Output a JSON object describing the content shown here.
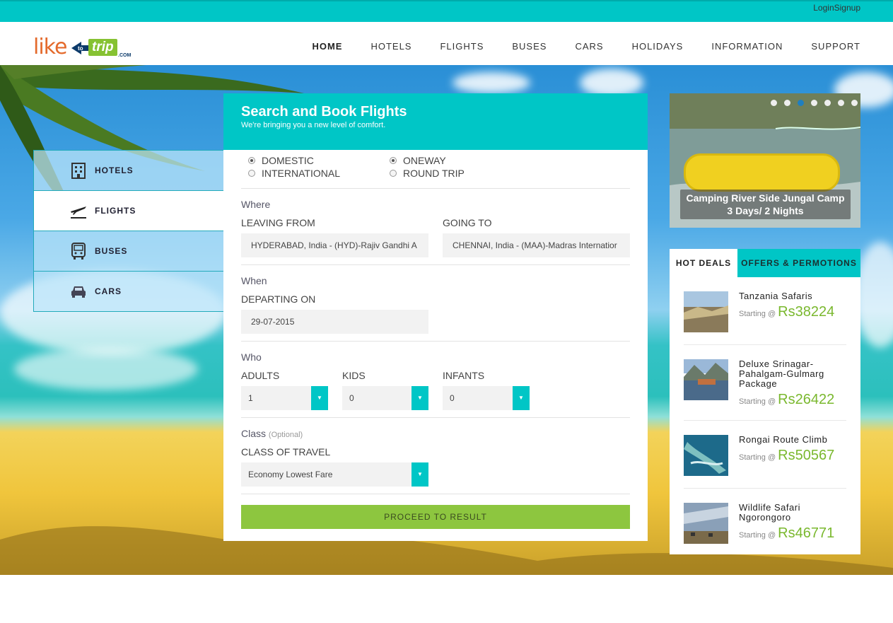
{
  "top_links": {
    "login": "Login",
    "signup": "Signup"
  },
  "logo": {
    "like": "like",
    "to": "to",
    "trip": "trip",
    "com": ".COM"
  },
  "nav": [
    "HOME",
    "HOTELS",
    "FLIGHTS",
    "BUSES",
    "CARS",
    "HOLIDAYS",
    "INFORMATION",
    "SUPPORT"
  ],
  "tabs": [
    {
      "label": "HOTELS",
      "icon": "hotel-icon"
    },
    {
      "label": "FLIGHTS",
      "icon": "plane-icon"
    },
    {
      "label": "BUSES",
      "icon": "bus-icon"
    },
    {
      "label": "CARS",
      "icon": "car-icon"
    }
  ],
  "form": {
    "title": "Search and Book Flights",
    "subtitle": "We're bringing you a new level of comfort.",
    "radios": {
      "domestic": "DOMESTIC",
      "international": "INTERNATIONAL",
      "oneway": "ONEWAY",
      "round_trip": "ROUND TRIP"
    },
    "where": {
      "title": "Where",
      "leaving_label": "LEAVING FROM",
      "leaving_value": "HYDERABAD, India - (HYD)-Rajiv Gandhi A",
      "going_label": "GOING TO",
      "going_value": "CHENNAI, India - (MAA)-Madras Internatior"
    },
    "when": {
      "title": "When",
      "departing_label": "DEPARTING ON",
      "departing_value": "29-07-2015"
    },
    "who": {
      "title": "Who",
      "adults_label": "ADULTS",
      "adults_value": "1",
      "kids_label": "KIDS",
      "kids_value": "0",
      "infants_label": "INFANTS",
      "infants_value": "0"
    },
    "class": {
      "title": "Class",
      "optional": "(Optional)",
      "label": "CLASS OF TRAVEL",
      "value": "Economy Lowest Fare"
    },
    "proceed": "PROCEED TO RESULT"
  },
  "slider": {
    "caption_line1": "Camping River Side Jungal Camp",
    "caption_line2": "3 Days/ 2 Nights",
    "active_dot": 2
  },
  "deals": {
    "tab_hot": "HOT DEALS",
    "tab_offers": "OFFERS & PERMOTIONS",
    "starting": "Starting @",
    "items": [
      {
        "name": "Tanzania Safaris",
        "price": "Rs38224"
      },
      {
        "name": "Deluxe Srinagar-Pahalgam-Gulmarg Package",
        "price": "Rs26422"
      },
      {
        "name": "Rongai Route Climb",
        "price": "Rs50567"
      },
      {
        "name": "Wildlife Safari Ngorongoro",
        "price": "Rs46771"
      }
    ]
  },
  "colors": {
    "accent": "#00c6c6",
    "green": "#8dc63f",
    "price": "#7ab82e",
    "logo_orange": "#e46a2c"
  }
}
